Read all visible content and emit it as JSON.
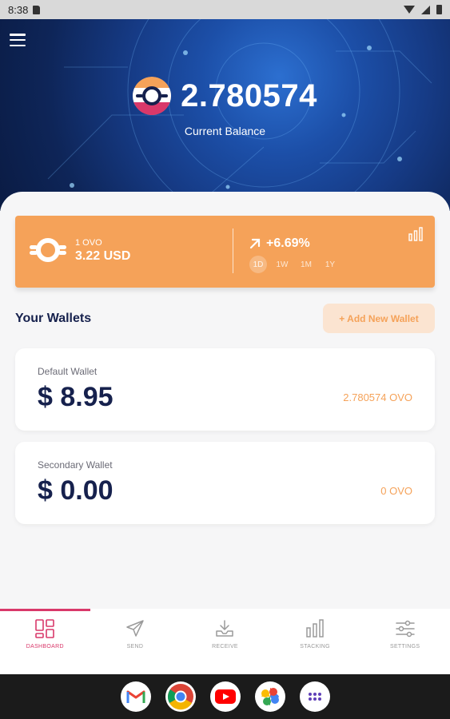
{
  "status_bar": {
    "time": "8:38"
  },
  "hero": {
    "balance": "2.780574",
    "balance_label": "Current Balance"
  },
  "price_card": {
    "unit": "1 OVO",
    "usd_value": "3.22 USD",
    "change": "+6.69%",
    "ranges": [
      "1D",
      "1W",
      "1M",
      "1Y"
    ],
    "active_range": "1D"
  },
  "wallets": {
    "title": "Your Wallets",
    "add_button": "+ Add New Wallet",
    "items": [
      {
        "name": "Default Wallet",
        "usd": "$ 8.95",
        "coin": "2.780574 OVO"
      },
      {
        "name": "Secondary Wallet",
        "usd": "$ 0.00",
        "coin": "0 OVO"
      }
    ]
  },
  "bottom_nav": {
    "items": [
      {
        "label": "DASHBOARD",
        "icon": "dashboard-icon",
        "active": true
      },
      {
        "label": "SEND",
        "icon": "send-icon",
        "active": false
      },
      {
        "label": "RECEIVE",
        "icon": "receive-icon",
        "active": false
      },
      {
        "label": "STACKING",
        "icon": "stacking-icon",
        "active": false
      },
      {
        "label": "SETTINGS",
        "icon": "settings-icon",
        "active": false
      }
    ]
  },
  "taskbar": {
    "apps": [
      "gmail-icon",
      "chrome-icon",
      "youtube-icon",
      "photos-icon",
      "app-drawer-icon"
    ]
  },
  "colors": {
    "accent_orange": "#f5a259",
    "navy_text": "#16214d",
    "active_pink": "#d9386a",
    "hero_blue": "#163b86"
  }
}
